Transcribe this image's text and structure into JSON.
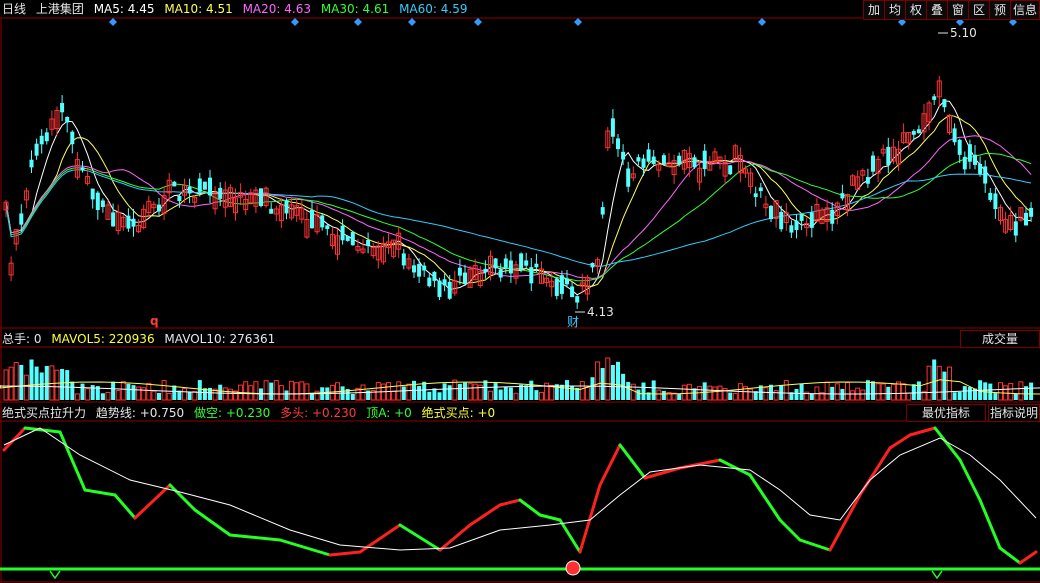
{
  "kline": {
    "period": "日线",
    "stock": "上港集团",
    "ma": [
      {
        "label": "MA5:",
        "value": "4.45",
        "color": "#ffffff"
      },
      {
        "label": "MA10:",
        "value": "4.51",
        "color": "#ffff55"
      },
      {
        "label": "MA20:",
        "value": "4.63",
        "color": "#ff66ff"
      },
      {
        "label": "MA30:",
        "value": "4.61",
        "color": "#33ff33"
      },
      {
        "label": "MA60:",
        "value": "4.59",
        "color": "#33ccff"
      }
    ],
    "high_label": "5.10",
    "low_label": "4.13",
    "finance_mark": "财",
    "marker_q": "q"
  },
  "toolbar": {
    "buttons": [
      "加",
      "均",
      "权",
      "叠",
      "窗",
      "区",
      "预",
      "信息"
    ]
  },
  "volume": {
    "total": "总手: 0",
    "mavol5_label": "MAVOL5:",
    "mavol5_value": "220936",
    "mavol10_label": "MAVOL10:",
    "mavol10_value": "276361",
    "button": "成交量"
  },
  "indicator": {
    "name": "绝式买点拉升力",
    "trend_label": "趋势线:",
    "trend_value": "+0.750",
    "short_label": "做空:",
    "short_value": "+0.230",
    "long_label": "多头:",
    "long_value": "+0.230",
    "topa_label": "顶A:",
    "topa_value": "+0",
    "buy_label": "绝式买点:",
    "buy_value": "+0",
    "best_button": "最优指标",
    "help_button": "指标说明"
  },
  "colors": {
    "up": "#ff3232",
    "down": "#54ffff",
    "frame": "#8b0000",
    "indicator_up": "#ff2020",
    "indicator_down": "#22ff22"
  }
}
